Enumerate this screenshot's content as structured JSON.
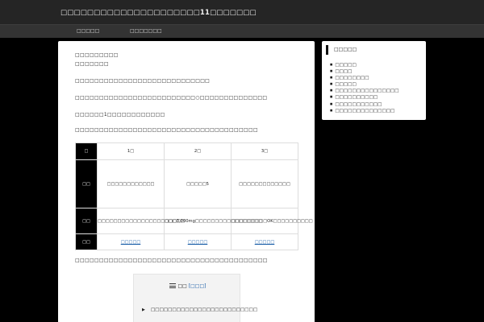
{
  "header": {
    "site_title": "□□□□□□□□□□□□□□□□□□□□□11□□□□□□□"
  },
  "nav": {
    "items": [
      {
        "label": "□□□□□"
      },
      {
        "label": "□□□□□□□"
      }
    ]
  },
  "article": {
    "intro_line_1": "□□□□□□□□□",
    "intro_line_2": "□□□□□□□",
    "paragraph_1": "□□□□□□□□□□□□□□□□□□□□□□□□□□□□",
    "paragraph_2": "□□□□□□□□□□□□□□□□□□□□□□□□□○□□□□□□□□□□□□□□",
    "paragraph_3": "□□□□□□1□□□□□□□□□□□□",
    "paragraph_4": "□□□□□□□□□□□□□□□□□□□□□□□□□□□□□□□□□□□□□□",
    "comparison_table": {
      "header_corner": "□",
      "columns": [
        "1□",
        "2□",
        "3□"
      ],
      "rows": [
        {
          "label": "□□",
          "cells": [
            "□□□□□□□□□□□□",
            "□□□□□5",
            "□□□□□□□□□□□□□"
          ]
        },
        {
          "label": "□□",
          "cells": [
            "□□□□□□□□□□□□□□□□□□□□□□",
            "□□□3,000mg□□□□□□□□□□□□□□□□□",
            "□□□□□□□□□OK□□□□□□□□□□"
          ]
        },
        {
          "label": "□□",
          "cells": [
            "□□□□□",
            "□□□□□",
            "□□□□□"
          ]
        }
      ]
    },
    "paragraph_5": "□□□□□□□□□□□□□□□□□□□□□□□□□□□□□□□□□□□□□□□□",
    "toc": {
      "title": "□□",
      "toggle_label": "[□□□]",
      "first_item": "□□□□□□□□□□□□□□□□□□□□□□□□□",
      "icon": "list-icon"
    }
  },
  "sidebar": {
    "widget_title": "□□□□□",
    "categories": [
      {
        "label": "□□□□□"
      },
      {
        "label": "□□□□"
      },
      {
        "label": "□□□□□□□□"
      },
      {
        "label": "□□□□□"
      },
      {
        "label": "□□□□□□□□□□□□□□□"
      },
      {
        "label": "□□□□□□□□□□"
      },
      {
        "label": "□□□□□□□□□□□"
      },
      {
        "label": "□□□□□□□□□□□□□□"
      }
    ]
  },
  "colors": {
    "background": "#000000",
    "header": "#252525",
    "nav": "#333333",
    "link": "#1a5ea8",
    "table_row_header": "#000000"
  }
}
